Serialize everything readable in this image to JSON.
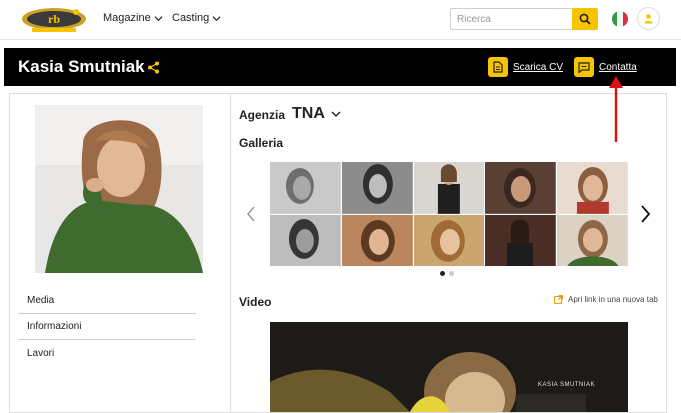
{
  "topnav": {
    "menu": [
      {
        "label": "Magazine"
      },
      {
        "label": "Casting"
      }
    ],
    "search": {
      "placeholder": "Ricerca",
      "value": ""
    }
  },
  "profile": {
    "name": "Kasia Smutniak",
    "actions": {
      "download_cv": "Scarica CV",
      "contact": "Contatta"
    }
  },
  "sidebar": {
    "items": [
      {
        "label": "Media"
      },
      {
        "label": "Informazioni"
      },
      {
        "label": "Lavori"
      }
    ]
  },
  "main": {
    "agency_label": "Agenzia",
    "agency_value": "TNA",
    "gallery_title": "Galleria",
    "gallery_pages": 2,
    "gallery_current_page": 1,
    "video_title": "Video",
    "open_new_tab": "Apri link in una nuova tab",
    "video_caption": "KASIA SMUTNIAK"
  },
  "colors": {
    "accent": "#f6c400",
    "header_bg": "#000000",
    "annotation_arrow": "#e01010"
  }
}
